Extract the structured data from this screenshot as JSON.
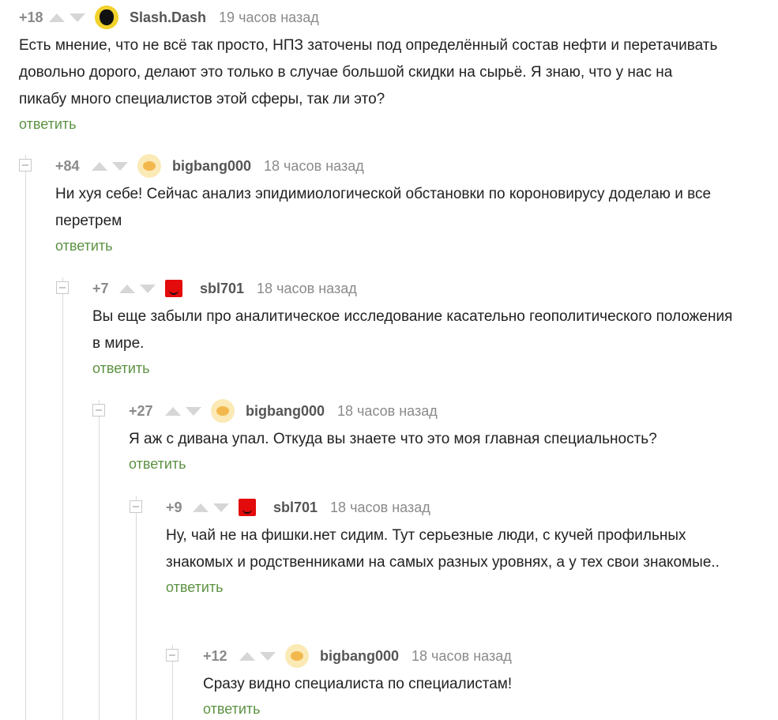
{
  "comments": [
    {
      "rating": "+18",
      "username": "Slash.Dash",
      "avatar": "slash-avatar",
      "time": "19 часов назад",
      "text": "Есть мнение, что не всё так просто, НПЗ заточены под определённый состав нефти и перетачивать довольно дорого, делают это только в случае большой скидки на сырьё. Я знаю, что у нас на пикабу много специалистов этой сферы, так ли это?",
      "reply": "ответить"
    },
    {
      "rating": "+84",
      "username": "bigbang000",
      "avatar": "bigbang-avatar",
      "time": "18 часов назад",
      "text": "Ни хуя себе! Сейчас анализ эпидимиологической обстановки  по короновирусу доделаю и все перетрем",
      "reply": "ответить"
    },
    {
      "rating": "+7",
      "username": "sbl701",
      "avatar": "sbl-avatar",
      "time": "18 часов назад",
      "text": "Вы еще забыли про аналитическое исследование касательно геополитического положения в мире.",
      "reply": "ответить"
    },
    {
      "rating": "+27",
      "username": "bigbang000",
      "avatar": "bigbang-avatar",
      "time": "18 часов назад",
      "text": "Я аж с дивана упал. Откуда вы знаете что это моя главная специальность?",
      "reply": "ответить"
    },
    {
      "rating": "+9",
      "username": "sbl701",
      "avatar": "sbl-avatar",
      "time": "18 часов назад",
      "text": "Ну, чай не на фишки.нет сидим. Тут серьезные люди, с кучей профильных знакомых и родственниками на самых разных уровнях, а у тех свои знакомые..",
      "reply": "ответить"
    },
    {
      "rating": "+12",
      "username": "bigbang000",
      "avatar": "bigbang-avatar",
      "time": "18 часов назад",
      "text": "Сразу видно специалиста по специалистам!",
      "reply": "ответить"
    }
  ],
  "colors": {
    "reply_link": "#5c9242",
    "muted": "#8a8a8a",
    "username": "#555555"
  }
}
